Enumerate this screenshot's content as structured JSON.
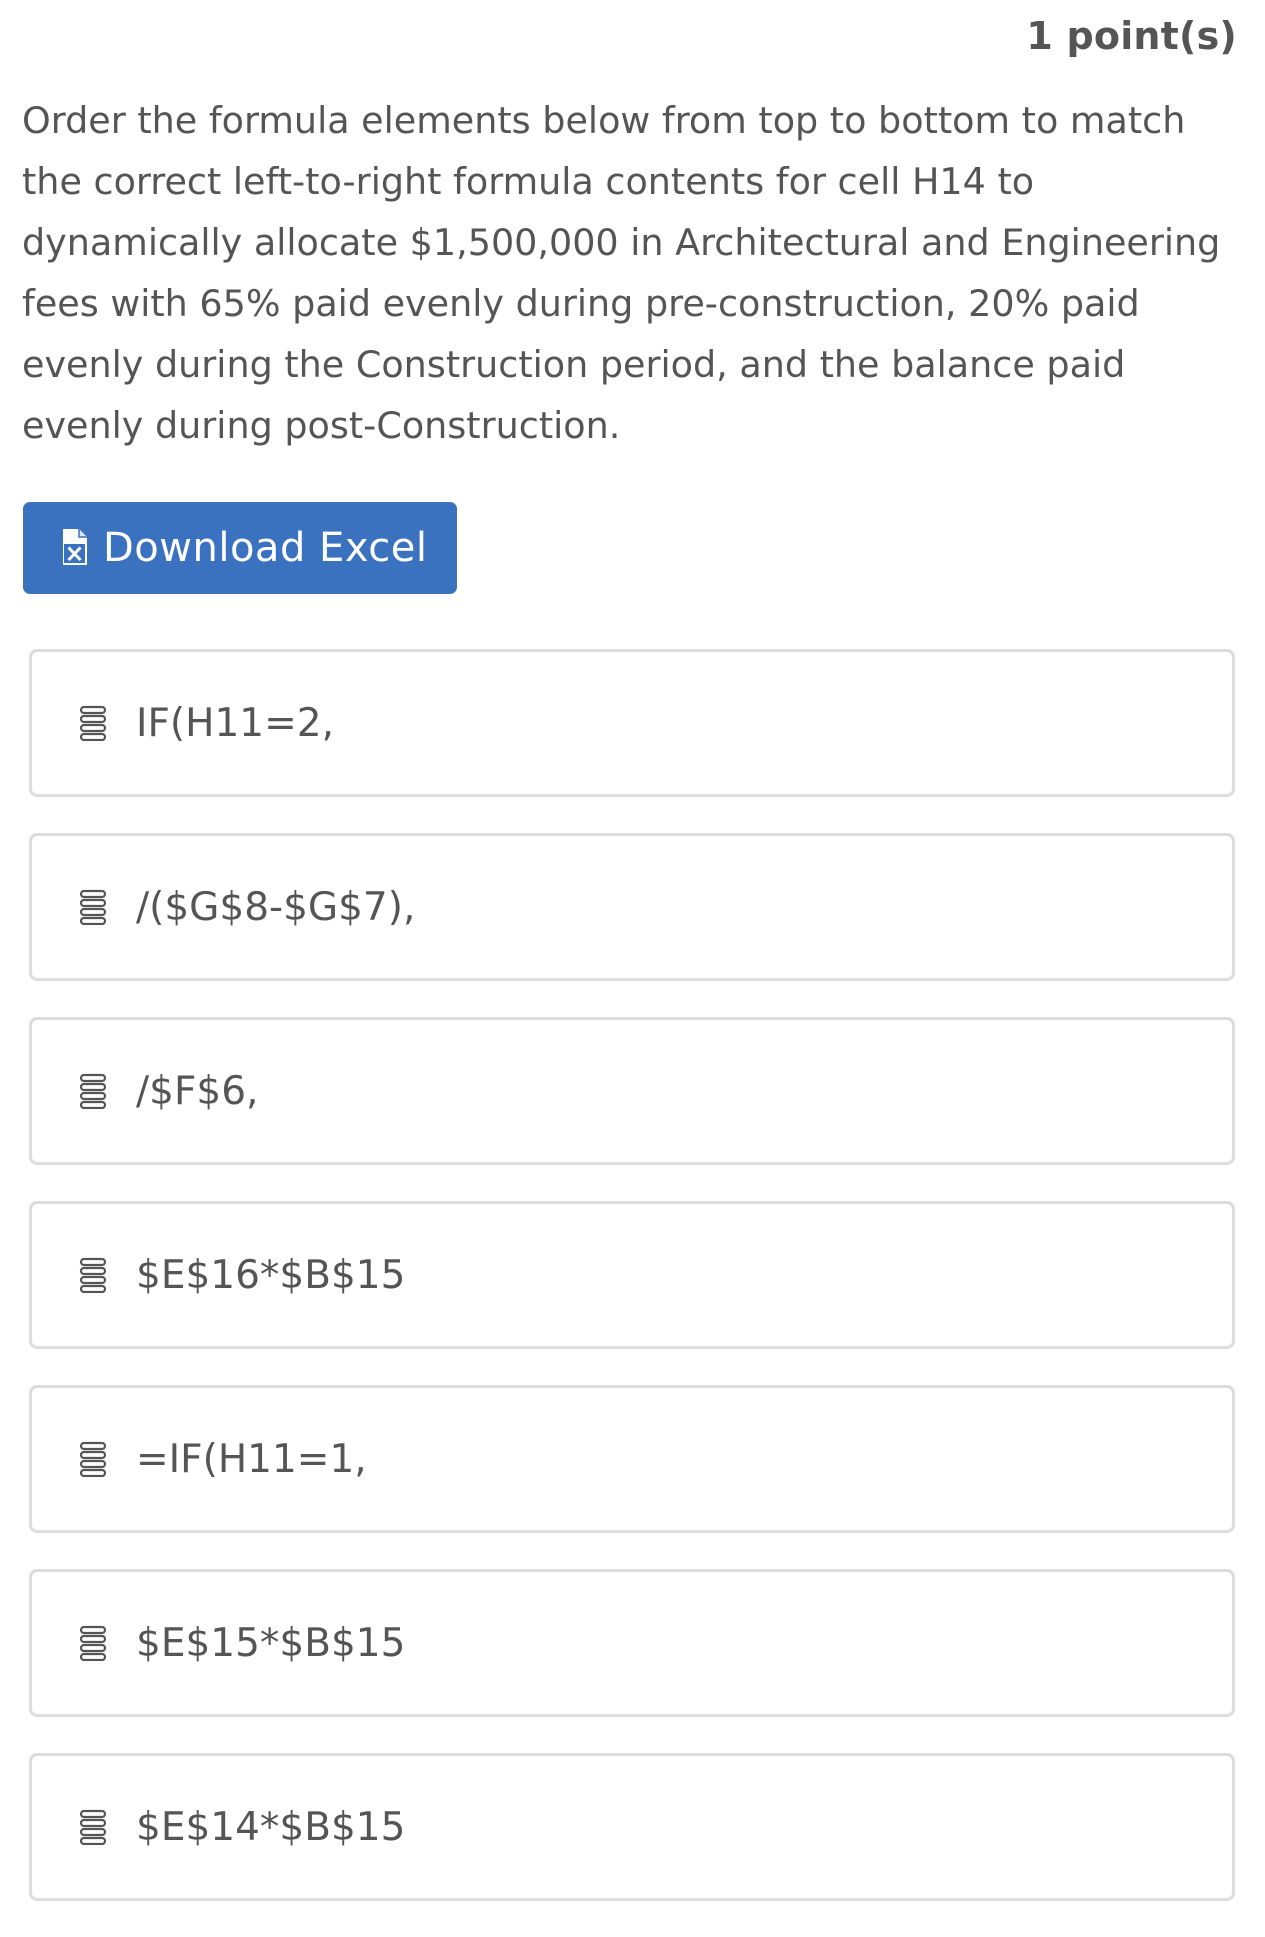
{
  "header": {
    "points": "1 point(s)"
  },
  "question": {
    "text": "Order the formula elements below from top to bottom to match the correct left-to-right formula contents for cell H14 to dynamically allocate $1,500,000 in Architectural and Engineering fees with 65% paid evenly during pre-construction, 20% paid evenly during the Construction period, and the balance paid evenly during post-Construction."
  },
  "download": {
    "label": "Download Excel",
    "icon": "excel-file-icon",
    "color": "#3a72c0"
  },
  "items": [
    {
      "label": "IF(H11=2,",
      "icon": "drag-handle-icon"
    },
    {
      "label": "/($G$8-$G$7),",
      "icon": "drag-handle-icon"
    },
    {
      "label": "/$F$6,",
      "icon": "drag-handle-icon"
    },
    {
      "label": "$E$16*$B$15",
      "icon": "drag-handle-icon"
    },
    {
      "label": "=IF(H11=1,",
      "icon": "drag-handle-icon"
    },
    {
      "label": "$E$15*$B$15",
      "icon": "drag-handle-icon"
    },
    {
      "label": "$E$14*$B$15",
      "icon": "drag-handle-icon"
    }
  ]
}
